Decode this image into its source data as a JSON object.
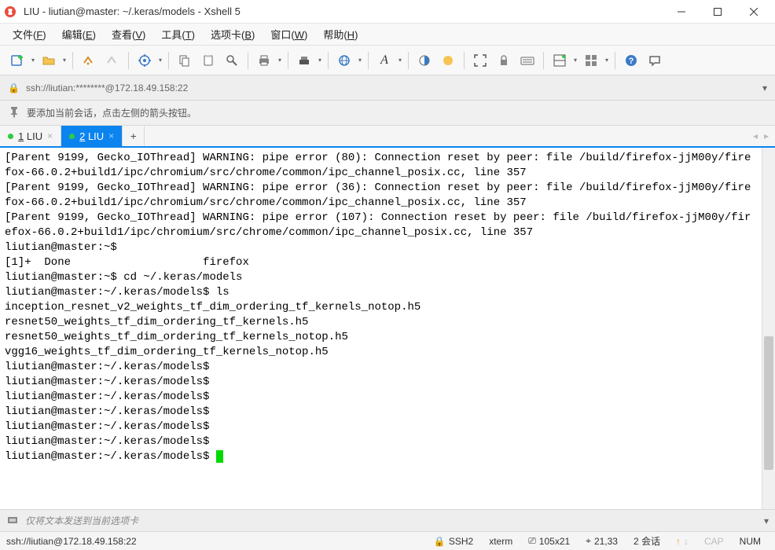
{
  "title": "LIU - liutian@master: ~/.keras/models - Xshell 5",
  "menu": [
    {
      "label": "文件(F)",
      "key": "F"
    },
    {
      "label": "编辑(E)",
      "key": "E"
    },
    {
      "label": "查看(V)",
      "key": "V"
    },
    {
      "label": "工具(T)",
      "key": "T"
    },
    {
      "label": "选项卡(B)",
      "key": "B"
    },
    {
      "label": "窗口(W)",
      "key": "W"
    },
    {
      "label": "帮助(H)",
      "key": "H"
    }
  ],
  "address": "ssh://liutian:********@172.18.49.158:22",
  "info_hint": "要添加当前会话，点击左侧的箭头按钮。",
  "tabs": [
    {
      "label": "1 LIU",
      "active": false
    },
    {
      "label": "2 LIU",
      "active": true
    }
  ],
  "terminal_lines": [
    "[Parent 9199, Gecko_IOThread] WARNING: pipe error (80): Connection reset by peer: file /build/firefox-jjM00y/firefox-66.0.2+build1/ipc/chromium/src/chrome/common/ipc_channel_posix.cc, line 357",
    "[Parent 9199, Gecko_IOThread] WARNING: pipe error (36): Connection reset by peer: file /build/firefox-jjM00y/firefox-66.0.2+build1/ipc/chromium/src/chrome/common/ipc_channel_posix.cc, line 357",
    "[Parent 9199, Gecko_IOThread] WARNING: pipe error (107): Connection reset by peer: file /build/firefox-jjM00y/firefox-66.0.2+build1/ipc/chromium/src/chrome/common/ipc_channel_posix.cc, line 357",
    "liutian@master:~$",
    "[1]+  Done                    firefox",
    "liutian@master:~$ cd ~/.keras/models",
    "liutian@master:~/.keras/models$ ls",
    "inception_resnet_v2_weights_tf_dim_ordering_tf_kernels_notop.h5",
    "resnet50_weights_tf_dim_ordering_tf_kernels.h5",
    "resnet50_weights_tf_dim_ordering_tf_kernels_notop.h5",
    "vgg16_weights_tf_dim_ordering_tf_kernels_notop.h5",
    "liutian@master:~/.keras/models$",
    "liutian@master:~/.keras/models$",
    "liutian@master:~/.keras/models$",
    "liutian@master:~/.keras/models$",
    "liutian@master:~/.keras/models$",
    "liutian@master:~/.keras/models$",
    "liutian@master:~/.keras/models$ "
  ],
  "cmd_placeholder": "仅将文本发送到当前选项卡",
  "status": {
    "connection": "ssh://liutian@172.18.49.158:22",
    "protocol": "SSH2",
    "term_type": "xterm",
    "size": "105x21",
    "cursor": "21,33",
    "sessions": "2 会话",
    "cap": "CAP",
    "num": "NUM"
  }
}
